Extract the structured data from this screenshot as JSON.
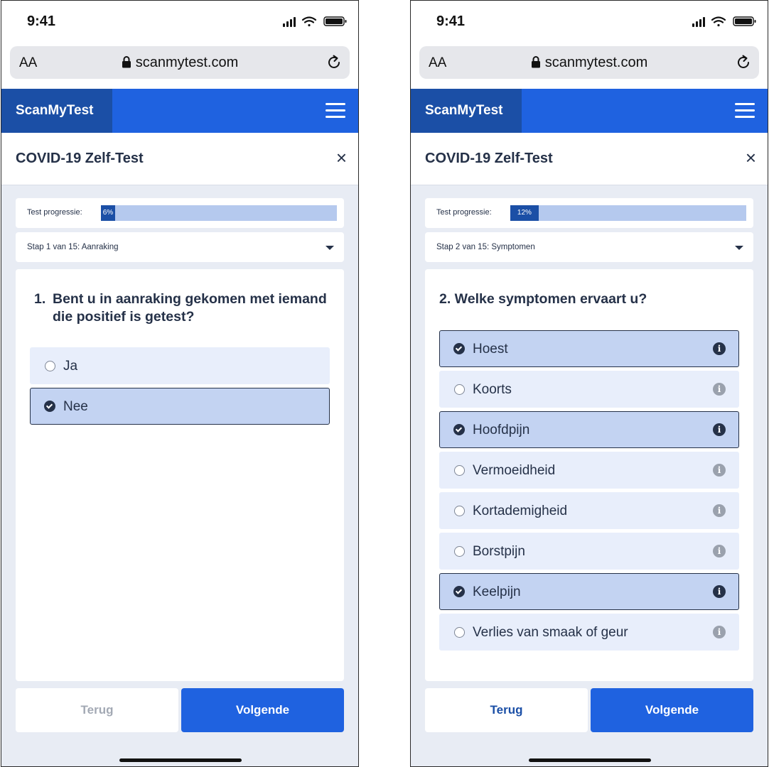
{
  "left": {
    "status": {
      "time": "9:41"
    },
    "browser": {
      "aa": "AA",
      "url": "scanmytest.com"
    },
    "nav": {
      "brand": "ScanMyTest"
    },
    "header": {
      "title": "COVID-19 Zelf-Test",
      "close": "×"
    },
    "progress": {
      "label": "Test progressie:",
      "value_text": "6%",
      "fraction": 0.06
    },
    "step": {
      "label": "Stap 1 van 15: Aanraking"
    },
    "question": {
      "number": "1.",
      "text": "Bent u in aanraking gekomen met iemand die positief is getest?"
    },
    "options": [
      {
        "label": "Ja",
        "selected": false
      },
      {
        "label": "Nee",
        "selected": true
      }
    ],
    "footer": {
      "back": "Terug",
      "next": "Volgende",
      "back_disabled": true
    }
  },
  "right": {
    "status": {
      "time": "9:41"
    },
    "browser": {
      "aa": "AA",
      "url": "scanmytest.com"
    },
    "nav": {
      "brand": "ScanMyTest"
    },
    "header": {
      "title": "COVID-19 Zelf-Test",
      "close": "×"
    },
    "progress": {
      "label": "Test progressie:",
      "value_text": "12%",
      "fraction": 0.12
    },
    "step": {
      "label": "Stap 2 van 15: Symptomen"
    },
    "question": {
      "text": "2. Welke symptomen ervaart u?"
    },
    "options": [
      {
        "label": "Hoest",
        "selected": true
      },
      {
        "label": "Koorts",
        "selected": false
      },
      {
        "label": "Hoofdpijn",
        "selected": true
      },
      {
        "label": "Vermoeidheid",
        "selected": false
      },
      {
        "label": "Kortademigheid",
        "selected": false
      },
      {
        "label": "Borstpijn",
        "selected": false
      },
      {
        "label": "Keelpijn",
        "selected": true
      },
      {
        "label": "Verlies van smaak of geur",
        "selected": false
      }
    ],
    "footer": {
      "back": "Terug",
      "next": "Volgende",
      "back_disabled": false
    }
  },
  "colors": {
    "primary": "#1f62e0",
    "brand_dark": "#1b4fa6",
    "text": "#253148",
    "option_bg": "#e8eefb",
    "option_selected_bg": "#c3d3f2",
    "page_bg": "#e8ecf4"
  }
}
